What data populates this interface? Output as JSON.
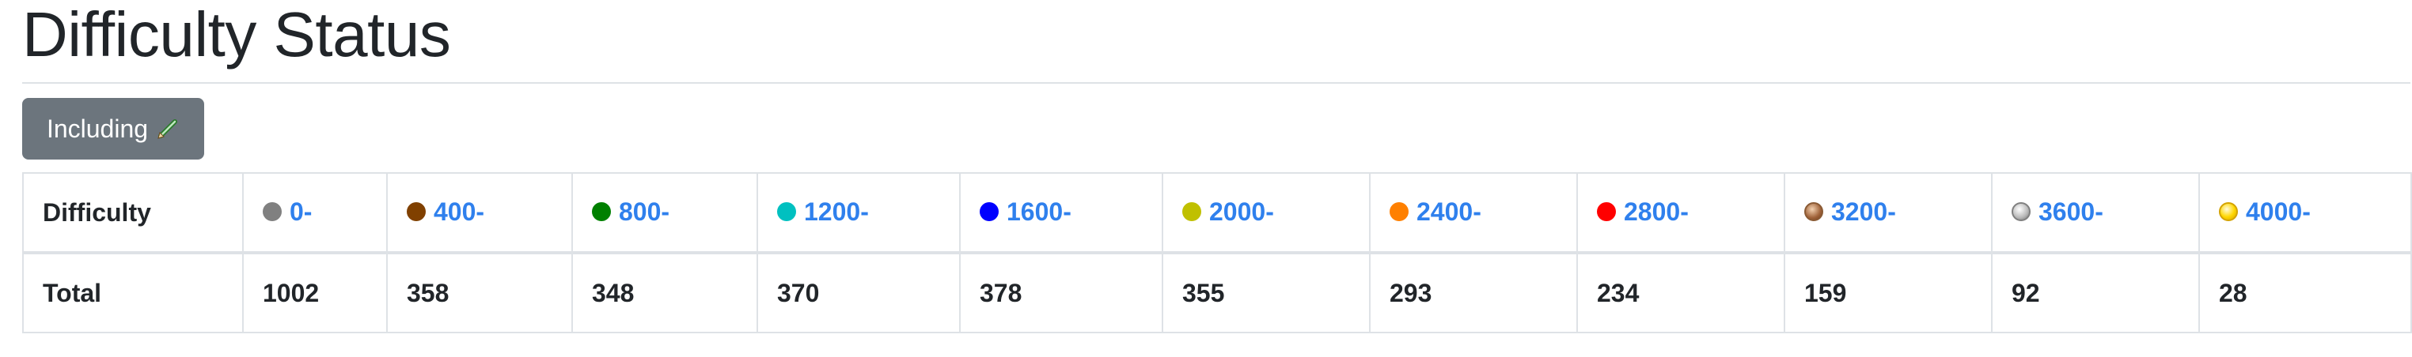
{
  "page": {
    "title": "Difficulty Status"
  },
  "toggle": {
    "label": "Including",
    "icon": "pencil-icon"
  },
  "table": {
    "header_label": "Difficulty",
    "row_label": "Total",
    "levels": [
      {
        "label": "0-",
        "color": "#808080",
        "style": "solid",
        "total": "1002"
      },
      {
        "label": "400-",
        "color": "#804000",
        "style": "solid",
        "total": "358"
      },
      {
        "label": "800-",
        "color": "#008000",
        "style": "solid",
        "total": "348"
      },
      {
        "label": "1200-",
        "color": "#00C0C0",
        "style": "solid",
        "total": "370"
      },
      {
        "label": "1600-",
        "color": "#0000FF",
        "style": "solid",
        "total": "378"
      },
      {
        "label": "2000-",
        "color": "#C0C000",
        "style": "solid",
        "total": "355"
      },
      {
        "label": "2400-",
        "color": "#FF8000",
        "style": "solid",
        "total": "293"
      },
      {
        "label": "2800-",
        "color": "#FF0000",
        "style": "solid",
        "total": "234"
      },
      {
        "label": "3200-",
        "color": "#965C2C",
        "style": "bronze",
        "total": "159"
      },
      {
        "label": "3600-",
        "color": "#808080",
        "style": "silver",
        "total": "92"
      },
      {
        "label": "4000-",
        "color": "#FFD700",
        "style": "gold",
        "total": "28"
      }
    ]
  },
  "colors": {
    "link": "#2f80ed",
    "button_bg": "#6c757d",
    "border": "#dee2e6"
  }
}
